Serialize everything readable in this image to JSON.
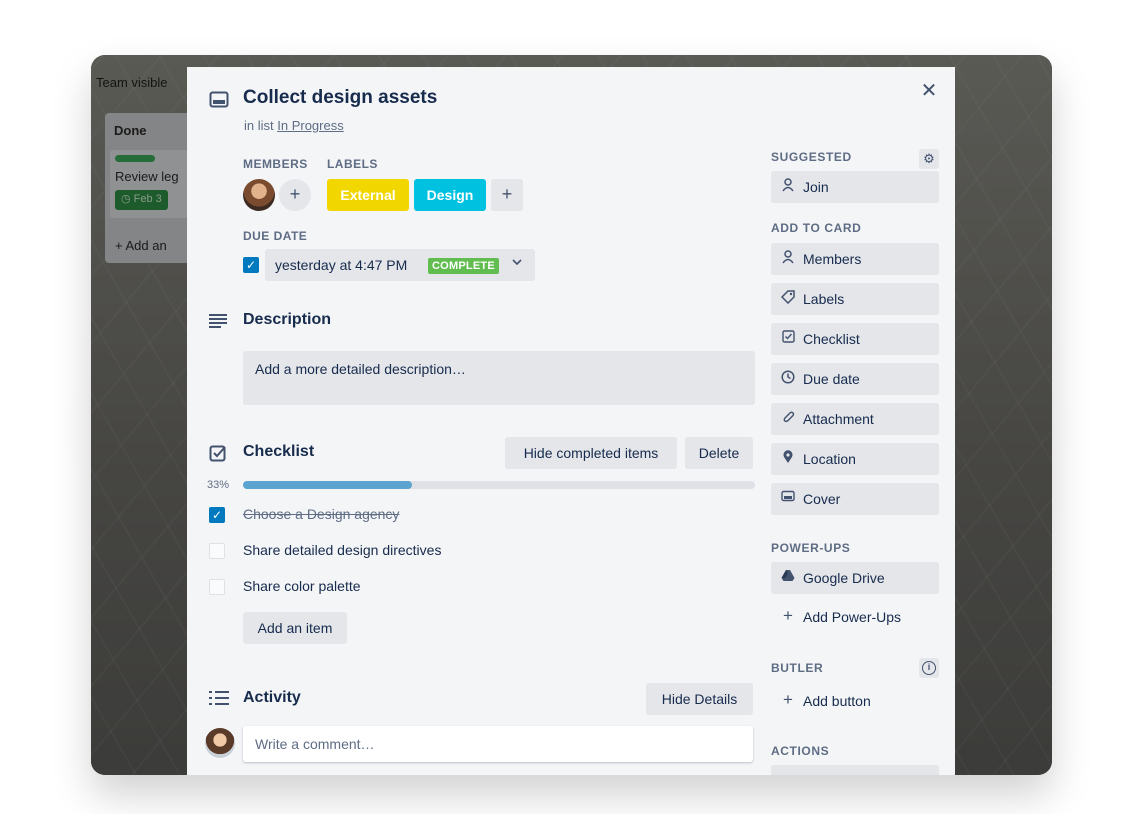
{
  "board": {
    "visibility": "Team visible",
    "list_title": "Done",
    "card_text": "Review leg",
    "card_due": "Feb 3",
    "add_another": "Add an"
  },
  "card": {
    "title": "Collect design assets",
    "in_list_prefix": "in list",
    "list_name": "In Progress",
    "members_heading": "MEMBERS",
    "labels_heading": "LABELS",
    "labels": [
      {
        "name": "External",
        "color": "#f2d600"
      },
      {
        "name": "Design",
        "color": "#00c2e0"
      }
    ],
    "due_heading": "DUE DATE",
    "due_text": "yesterday at 4:47 PM",
    "due_status": "COMPLETE",
    "due_checked": true
  },
  "description": {
    "title": "Description",
    "placeholder": "Add a more detailed description…"
  },
  "checklist": {
    "title": "Checklist",
    "hide_completed": "Hide completed items",
    "delete": "Delete",
    "progress_label": "33%",
    "progress": 0.33,
    "items": [
      {
        "text": "Choose a Design agency",
        "checked": true
      },
      {
        "text": "Share detailed design directives",
        "checked": false
      },
      {
        "text": "Share color palette",
        "checked": false
      }
    ],
    "add_item": "Add an item"
  },
  "activity": {
    "title": "Activity",
    "hide_details": "Hide Details",
    "comment_placeholder": "Write a comment…"
  },
  "sidebar": {
    "suggested_heading": "SUGGESTED",
    "join": "Join",
    "add_to_card_heading": "ADD TO CARD",
    "add_to_card": [
      {
        "label": "Members",
        "icon": "person-icon"
      },
      {
        "label": "Labels",
        "icon": "tag-icon"
      },
      {
        "label": "Checklist",
        "icon": "checklist-icon"
      },
      {
        "label": "Due date",
        "icon": "clock-icon"
      },
      {
        "label": "Attachment",
        "icon": "paperclip-icon"
      },
      {
        "label": "Location",
        "icon": "pin-icon"
      },
      {
        "label": "Cover",
        "icon": "cover-icon"
      }
    ],
    "powerups_heading": "POWER-UPS",
    "google_drive": "Google Drive",
    "add_powerups": "Add Power-Ups",
    "butler_heading": "BUTLER",
    "add_button": "Add button",
    "actions_heading": "ACTIONS"
  },
  "colors": {
    "accent": "#0079bf",
    "progress": "#5ba4cf",
    "complete": "#61bd4f"
  }
}
